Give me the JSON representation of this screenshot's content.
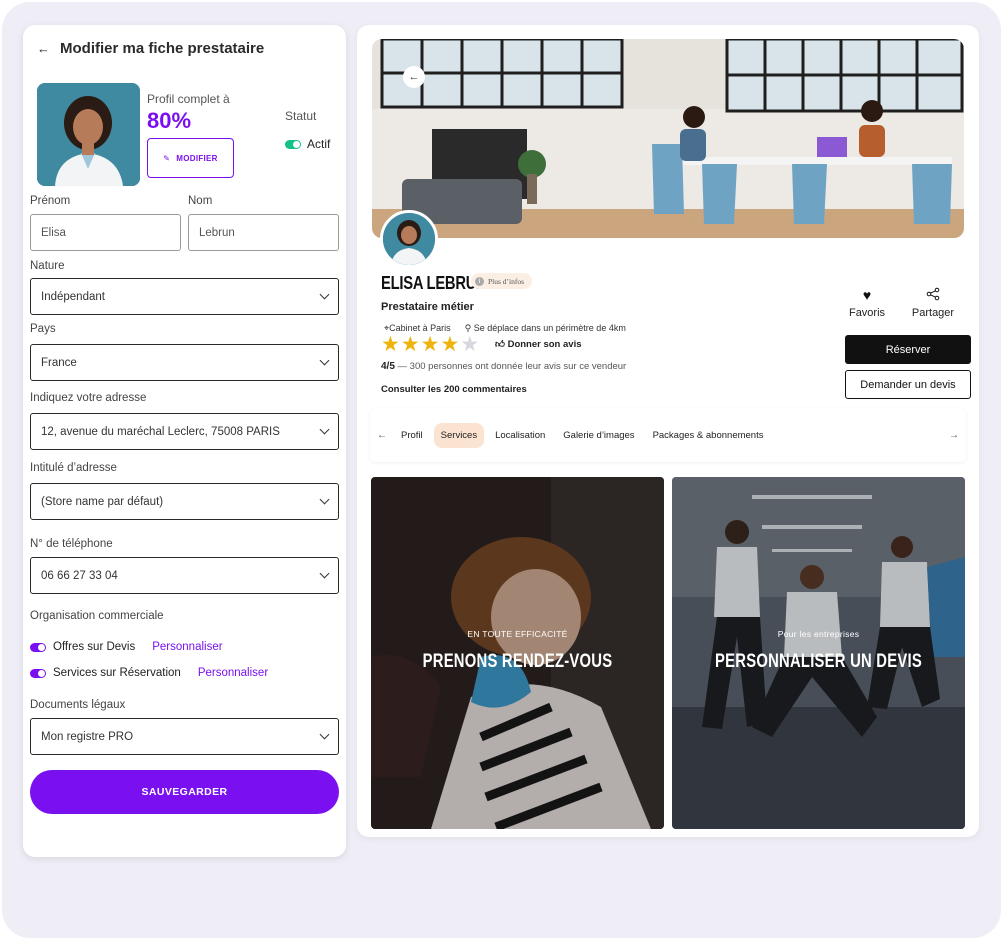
{
  "editor": {
    "back_icon": "arrow-left-icon",
    "title": "Modifier ma fiche prestataire",
    "completion_label": "Profil complet à",
    "completion_value": "80%",
    "modify_label": "MODIFIER",
    "status_label": "Statut",
    "status_value": "Actif",
    "first_name": {
      "label": "Prénom",
      "value": "Elisa"
    },
    "last_name": {
      "label": "Nom",
      "value": "Lebrun"
    },
    "nature": {
      "label": "Nature",
      "value": "Indépendant"
    },
    "country": {
      "label": "Pays",
      "value": "France"
    },
    "address": {
      "label": "Indiquez votre adresse",
      "value": "12, avenue du maréchal Leclerc, 75008 PARIS"
    },
    "address_title": {
      "label": "Intitulé d’adresse",
      "value": "(Store name par défaut)"
    },
    "phone": {
      "label": "N° de téléphone",
      "value": "06 66 27 33 04"
    },
    "org_label": "Organisation commerciale",
    "switches": [
      {
        "label": "Offres sur Devis",
        "link": "Personnaliser"
      },
      {
        "label": "Services sur Réservation",
        "link": "Personnaliser"
      }
    ],
    "documents": {
      "label": "Documents légaux",
      "value": "Mon registre PRO"
    },
    "save_label": "SAUVEGARDER"
  },
  "profile": {
    "name": "ELISA LEBRUN",
    "info_badge": "Plus d’infos",
    "role": "Prestataire métier",
    "location": "Cabinet à Paris",
    "travel": "Se déplace dans un périmètre de 4km",
    "rating": 4,
    "rating_max": 5,
    "give_review": "Donner son avis",
    "rating_score": "4/5",
    "rating_text": " — 300 personnes ont donnée leur avis sur ce vendeur",
    "comments_link": "Consulter les 200 commentaires",
    "favorite_label": "Favoris",
    "share_label": "Partager",
    "book_label": "Réserver",
    "quote_label": "Demander un devis"
  },
  "tabs": [
    "Profil",
    "Services",
    "Localisation",
    "Galerie d’images",
    "Packages & abonnements"
  ],
  "active_tab": "Services",
  "cards": [
    {
      "subtitle": "EN TOUTE EFFICACITÉ",
      "title": "PRENONS RENDEZ-VOUS"
    },
    {
      "subtitle": "Pour les entreprises",
      "title": "PERSONNALISER UN DEVIS"
    }
  ],
  "colors": {
    "accent": "#7a10f0",
    "toggle_active": "#16c08a",
    "star": "#efb30b",
    "active_tab_bg": "#fbe3d1"
  }
}
